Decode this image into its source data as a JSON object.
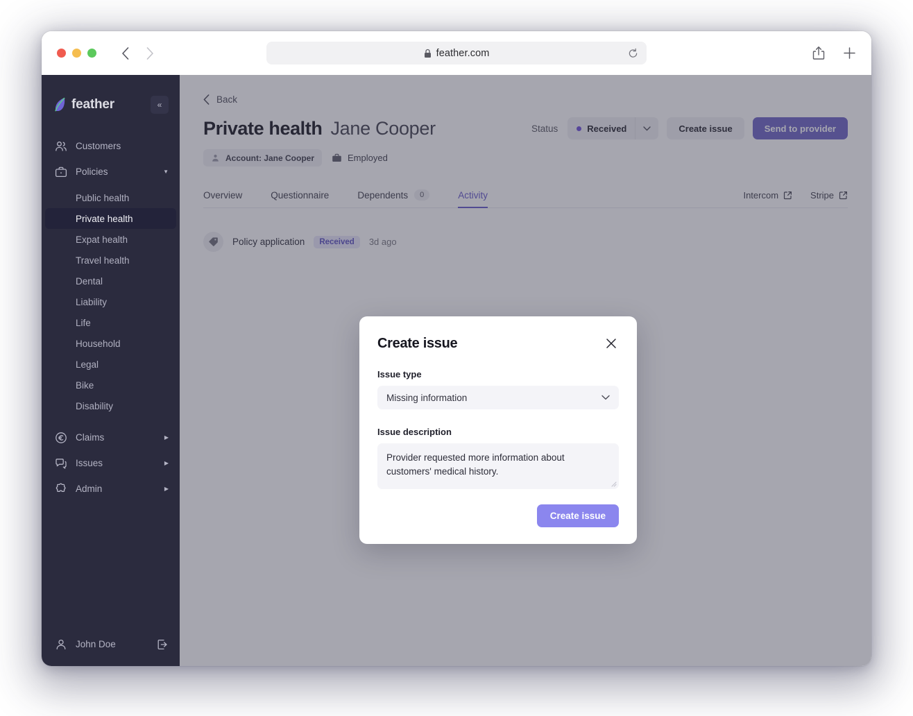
{
  "browser": {
    "url": "feather.com",
    "lock_icon": "lock-icon",
    "reload_icon": "reload-icon",
    "back_icon": "chevron-left-icon",
    "forward_icon": "chevron-right-icon",
    "share_icon": "share-icon",
    "new_tab_icon": "plus-icon"
  },
  "sidebar": {
    "brand": "feather",
    "brand_icon": "feather-quill-icon",
    "collapse_icon": "«",
    "items": [
      {
        "label": "Customers",
        "icon": "users-icon",
        "caret": ""
      },
      {
        "label": "Policies",
        "icon": "briefcase-icon",
        "caret": "▼"
      }
    ],
    "policies_children": [
      {
        "label": "Public health",
        "active": false
      },
      {
        "label": "Private health",
        "active": true
      },
      {
        "label": "Expat health",
        "active": false
      },
      {
        "label": "Travel health",
        "active": false
      },
      {
        "label": "Dental",
        "active": false
      },
      {
        "label": "Liability",
        "active": false
      },
      {
        "label": "Life",
        "active": false
      },
      {
        "label": "Household",
        "active": false
      },
      {
        "label": "Legal",
        "active": false
      },
      {
        "label": "Bike",
        "active": false
      },
      {
        "label": "Disability",
        "active": false
      }
    ],
    "bottom_items": [
      {
        "label": "Claims",
        "icon": "euro-circle-icon",
        "caret": "▶"
      },
      {
        "label": "Issues",
        "icon": "chat-icon",
        "caret": "▶"
      },
      {
        "label": "Admin",
        "icon": "puzzle-icon",
        "caret": "▶"
      }
    ],
    "user": "John Doe",
    "user_icon": "person-icon",
    "logout_icon": "logout-icon"
  },
  "main": {
    "back_label": "Back",
    "back_icon": "chevron-left-icon",
    "title": "Private health",
    "subtitle": "Jane Cooper",
    "status_label": "Status",
    "status_value": "Received",
    "status_dot_color": "#6c4fd8",
    "create_issue_button": "Create issue",
    "send_provider_button": "Send to provider",
    "badges": [
      {
        "label": "Account: Jane Cooper",
        "icon": "person-icon",
        "chip": true
      },
      {
        "label": "Employed",
        "icon": "briefcase-icon",
        "chip": false
      }
    ],
    "tabs": [
      {
        "label": "Overview",
        "count": null,
        "active": false
      },
      {
        "label": "Questionnaire",
        "count": null,
        "active": false
      },
      {
        "label": "Dependents",
        "count": "0",
        "active": false
      },
      {
        "label": "Activity",
        "count": null,
        "active": true
      }
    ],
    "external_links": [
      {
        "label": "Intercom",
        "icon": "external-link-icon"
      },
      {
        "label": "Stripe",
        "icon": "external-link-icon"
      }
    ],
    "activity": [
      {
        "icon": "tag-icon",
        "text": "Policy application",
        "badge": "Received",
        "time": "3d ago"
      }
    ]
  },
  "modal": {
    "title": "Create issue",
    "close_icon": "close-icon",
    "issue_type_label": "Issue type",
    "issue_type_value": "Missing information",
    "issue_type_chevron": "chevron-down-icon",
    "issue_description_label": "Issue description",
    "issue_description_value": "Provider requested more information about customers' medical history.",
    "submit_label": "Create issue"
  },
  "colors": {
    "accent_purple": "#6255c9",
    "button_purple": "#8b86ee",
    "primary_purple": "#6b63c4",
    "sidebar_bg": "#2b2b3e",
    "sidebar_active": "#23233a",
    "overlay": "#8b8b96"
  }
}
